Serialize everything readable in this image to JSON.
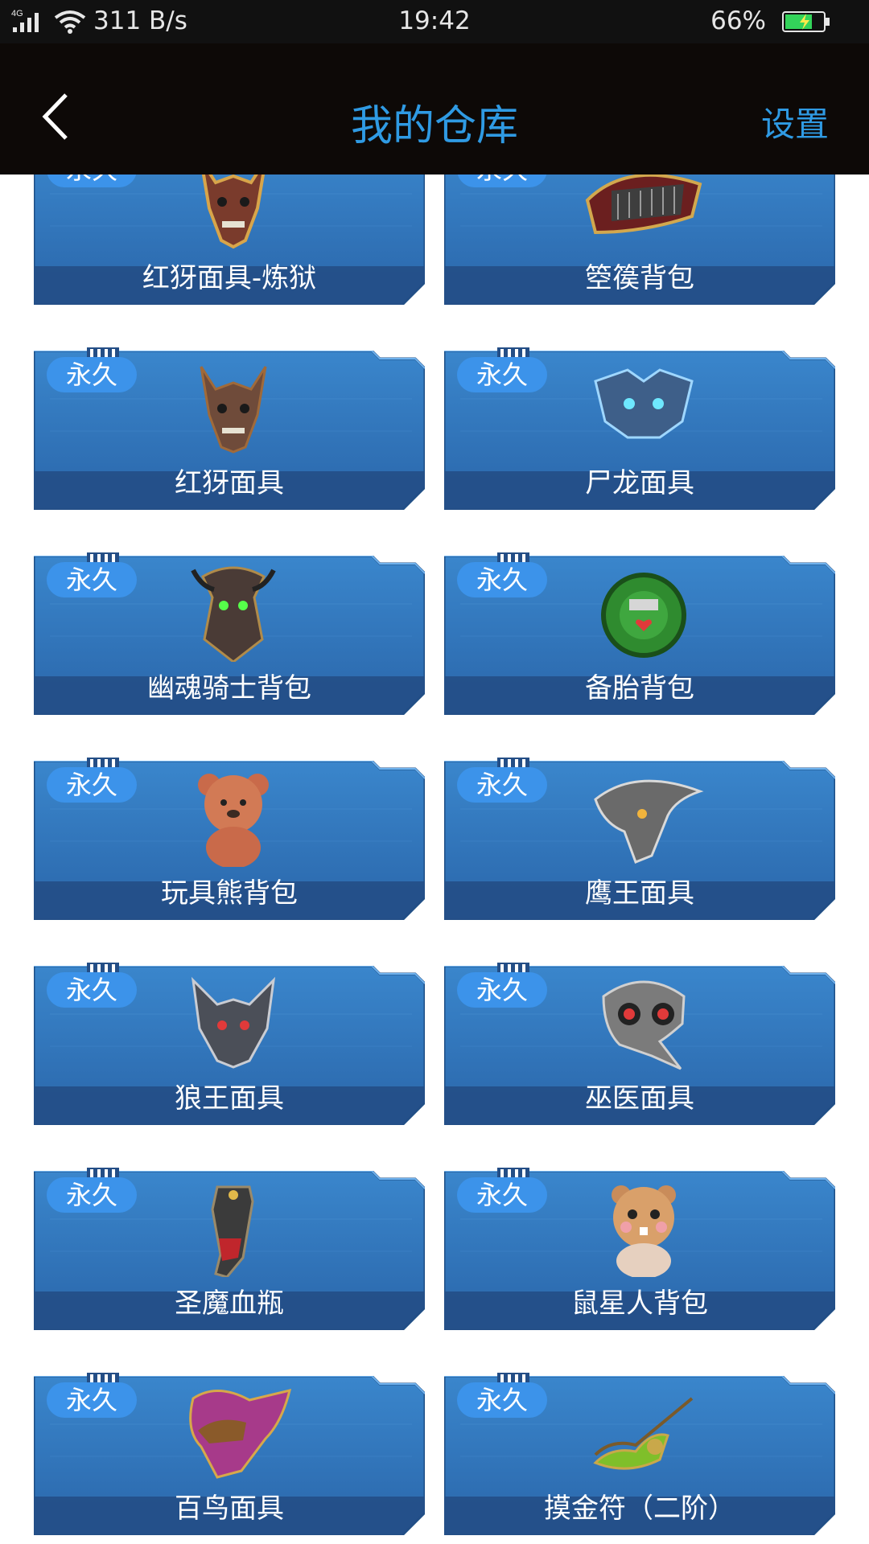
{
  "status_bar": {
    "network": "4G",
    "speed": "311 B/s",
    "time": "19:42",
    "battery": "66%"
  },
  "header": {
    "title": "我的仓库",
    "settings_label": "设置"
  },
  "colors": {
    "accent": "#2f9ae3",
    "card_blue": "#2b6fb4",
    "badge": "#3c93ea"
  },
  "items": [
    {
      "badge": "永久",
      "name": "红犽面具-炼狱",
      "icon": "demon-mask-gold-icon"
    },
    {
      "badge": "永久",
      "name": "箜篌背包",
      "icon": "harp-backpack-icon"
    },
    {
      "badge": "永久",
      "name": "红犽面具",
      "icon": "demon-mask-icon"
    },
    {
      "badge": "永久",
      "name": "尸龙面具",
      "icon": "dragon-mask-icon"
    },
    {
      "badge": "永久",
      "name": "幽魂骑士背包",
      "icon": "ghost-knight-backpack-icon"
    },
    {
      "badge": "永久",
      "name": "备胎背包",
      "icon": "tire-backpack-icon"
    },
    {
      "badge": "永久",
      "name": "玩具熊背包",
      "icon": "teddy-bear-backpack-icon"
    },
    {
      "badge": "永久",
      "name": "鹰王面具",
      "icon": "eagle-mask-icon"
    },
    {
      "badge": "永久",
      "name": "狼王面具",
      "icon": "wolf-mask-icon"
    },
    {
      "badge": "永久",
      "name": "巫医面具",
      "icon": "plague-doctor-mask-icon"
    },
    {
      "badge": "永久",
      "name": "圣魔血瓶",
      "icon": "blood-bottle-icon"
    },
    {
      "badge": "永久",
      "name": "鼠星人背包",
      "icon": "hamster-backpack-icon"
    },
    {
      "badge": "永久",
      "name": "百鸟面具",
      "icon": "feather-mask-icon"
    },
    {
      "badge": "永久",
      "name": "摸金符（二阶）",
      "icon": "talisman-icon"
    }
  ]
}
